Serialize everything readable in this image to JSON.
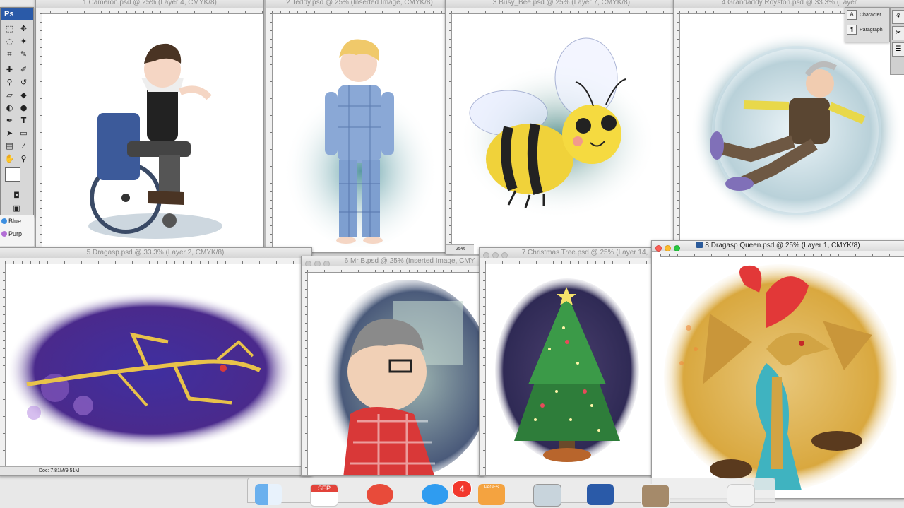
{
  "app": {
    "name": "Ps"
  },
  "windows": [
    {
      "title": "1 Cameron.psd @ 25% (Layer 4, CMYK/8)"
    },
    {
      "title": "2 Teddy.psd @ 25% (Inserted Image, CMYK/8)"
    },
    {
      "title": "3 Busy_Bee.psd @ 25% (Layer 7, CMYK/8)",
      "zoom": "25%"
    },
    {
      "title": "4 Grandaddy Royston.psd @ 33.3% (Layer"
    },
    {
      "title": "5 Dragasp.psd @ 33.3% (Layer 2, CMYK/8)",
      "doc": "Doc: 7.81M/9.51M"
    },
    {
      "title": "6 Mr B.psd @ 25% (Inserted Image, CMY"
    },
    {
      "title": "7 Christmas Tree.psd @ 25% (Layer 14,"
    },
    {
      "title": "8 Dragasp Queen.psd @ 25% (Layer 1, CMYK/8)"
    }
  ],
  "panel": {
    "character": "Character",
    "paragraph": "Paragraph"
  },
  "labels": [
    {
      "text": "Blue",
      "color": "#3d8fe0"
    },
    {
      "text": "Purp",
      "color": "#b36fd6"
    }
  ],
  "dock": {
    "calendar_month": "SEP",
    "badge": "4",
    "pages_label": "PAGES"
  },
  "colors": {
    "ps_blue": "#2a5aa8",
    "dock_bg": "#ebebeb",
    "badge_red": "#f2382d"
  }
}
